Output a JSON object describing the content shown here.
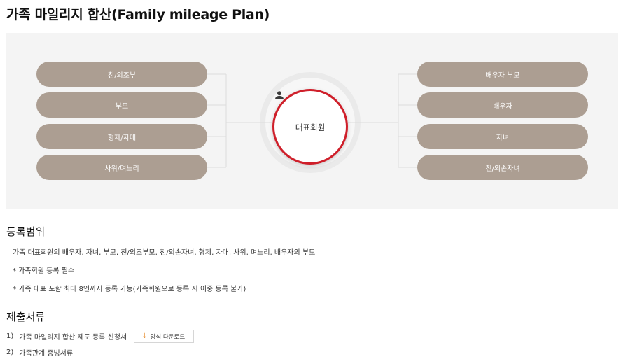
{
  "page": {
    "title": "가족 마일리지 합산(Family mileage Plan)"
  },
  "diagram": {
    "center_label": "대표회원",
    "left_items": [
      "친/외조부",
      "부모",
      "형제/자매",
      "사위/며느리"
    ],
    "right_items": [
      "배우자 부모",
      "배우자",
      "자녀",
      "친/외손자녀"
    ],
    "colors": {
      "pill": "#ac9e92",
      "ring": "#cf1f2a",
      "panel": "#f4f4f4"
    }
  },
  "registration": {
    "title": "등록범위",
    "lines": [
      "가족 대표회원의 배우자, 자녀, 부모, 친/외조부모, 친/외손자녀, 형제, 자매, 사위, 며느리, 배우자의 부모",
      "* 가족회원 등록 필수",
      "* 가족 대표 포함 최대 8인까지 등록 가능(가족회원으로 등록 시 이중 등록 불가)"
    ]
  },
  "documents": {
    "title": "제출서류",
    "items": [
      {
        "num": "1)",
        "text": "가족 마일리지 합산 제도 등록 신청서",
        "button": "양식 다운로드"
      },
      {
        "num": "2)",
        "text": "가족관계 증빙서류"
      }
    ]
  }
}
